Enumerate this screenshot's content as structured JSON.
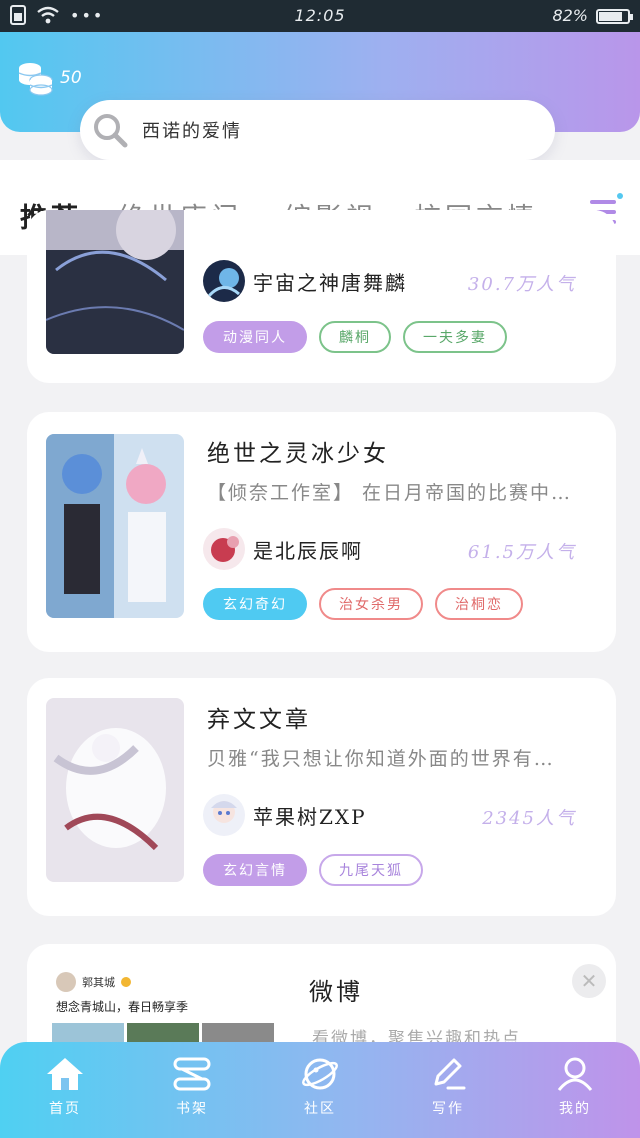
{
  "status_bar": {
    "time": "12:05",
    "battery": "82%",
    "battery_level": 0.82
  },
  "coins": {
    "count": "50"
  },
  "search": {
    "query": "西诺的爱情"
  },
  "tabs": [
    {
      "label": "推荐",
      "active": true
    },
    {
      "label": "绝世唐门",
      "active": false
    },
    {
      "label": "综影视",
      "active": false
    },
    {
      "label": "校园言情",
      "active": false
    }
  ],
  "cards": [
    {
      "author": "宇宙之神唐舞麟",
      "popularity": "30.7万人气",
      "tags": [
        {
          "label": "动漫同人",
          "style": "filled-purple"
        },
        {
          "label": "麟桐",
          "style": "outline-green"
        },
        {
          "label": "一夫多妻",
          "style": "outline-green"
        }
      ]
    },
    {
      "title": "绝世之灵冰少女",
      "description": "【倾奈工作室】 在日月帝国的比赛中…",
      "author": "是北辰辰啊",
      "popularity": "61.5万人气",
      "tags": [
        {
          "label": "玄幻奇幻",
          "style": "filled-blue"
        },
        {
          "label": "治女杀男",
          "style": "outline-red"
        },
        {
          "label": "治桐恋",
          "style": "outline-red"
        }
      ]
    },
    {
      "title": "弃文文章",
      "description": "贝雅“我只想让你知道外面的世界有…",
      "author": "苹果树ZXP",
      "popularity": "2345人气",
      "tags": [
        {
          "label": "玄幻言情",
          "style": "filled-purple"
        },
        {
          "label": "九尾天狐",
          "style": "outline-purple"
        }
      ]
    }
  ],
  "ad": {
    "title": "微博",
    "description": "看微博，聚焦兴趣和热点",
    "post_user": "郭其城",
    "post_text": "想念青城山，春日畅享季"
  },
  "bottom_nav": [
    {
      "label": "首页",
      "icon": "home-icon"
    },
    {
      "label": "书架",
      "icon": "bookshelf-icon"
    },
    {
      "label": "社区",
      "icon": "planet-icon"
    },
    {
      "label": "写作",
      "icon": "pen-icon"
    },
    {
      "label": "我的",
      "icon": "user-icon"
    }
  ]
}
